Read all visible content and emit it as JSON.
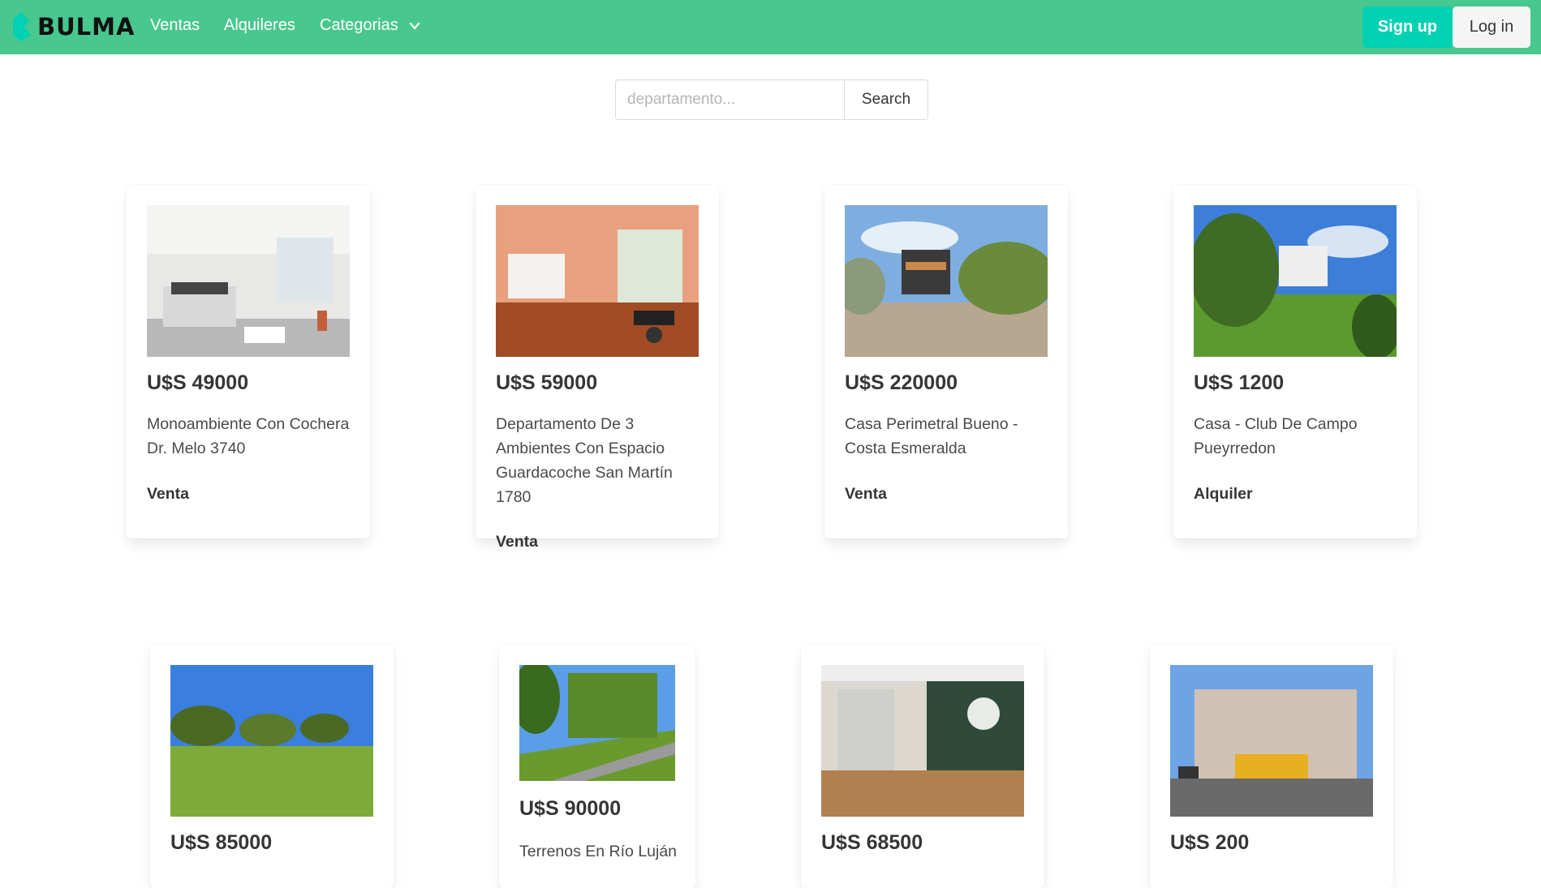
{
  "navbar": {
    "brand": "BULMA",
    "items": [
      "Ventas",
      "Alquileres",
      "Categorias"
    ],
    "signup_label": "Sign up",
    "login_label": "Log in",
    "accent_color": "#48c78e",
    "signup_color": "#00d1b2"
  },
  "search": {
    "placeholder": "departamento...",
    "button_label": "Search"
  },
  "listings": [
    {
      "price": "U$S 49000",
      "title": "Monoambiente Con Cochera Dr. Melo 3740",
      "type": "Venta"
    },
    {
      "price": "U$S 59000",
      "title": "Departamento De 3 Ambientes Con Espacio Guardacoche San Martín 1780",
      "type": "Venta"
    },
    {
      "price": "U$S 220000",
      "title": "Casa Perimetral Bueno - Costa Esmeralda",
      "type": "Venta"
    },
    {
      "price": "U$S 1200",
      "title": "Casa - Club De Campo Pueyrredon",
      "type": "Alquiler"
    },
    {
      "price": "U$S 85000"
    },
    {
      "price": "U$S 90000",
      "title": "Terrenos En Río Luján"
    },
    {
      "price": "U$S 68500"
    },
    {
      "price": "U$S 200"
    }
  ]
}
